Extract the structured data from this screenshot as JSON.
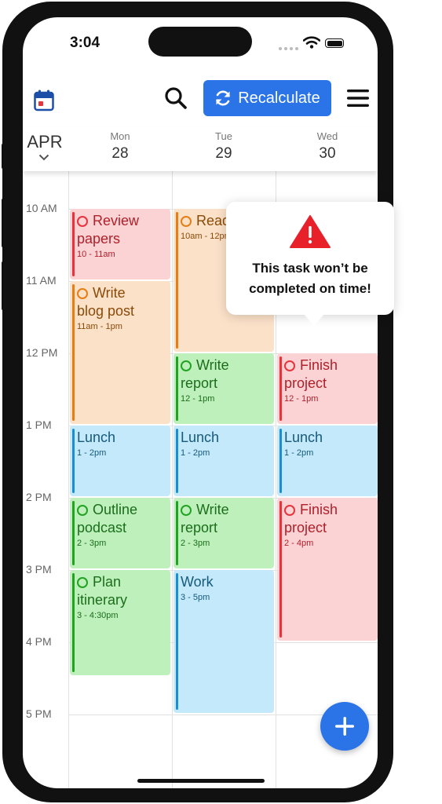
{
  "status_bar": {
    "time": "3:04"
  },
  "toolbar": {
    "recalculate_label": "Recalculate"
  },
  "header": {
    "month": "APR",
    "days": [
      {
        "name": "Mon",
        "date": "28"
      },
      {
        "name": "Tue",
        "date": "29"
      },
      {
        "name": "Wed",
        "date": "30"
      }
    ]
  },
  "time_labels": [
    "10 AM",
    "11 AM",
    "12 PM",
    "1 PM",
    "2 PM",
    "3 PM",
    "4 PM",
    "5 PM"
  ],
  "events": {
    "mon": [
      {
        "title1": "Review",
        "title2": "papers",
        "time": "10 - 11am"
      },
      {
        "title1": "Write",
        "title2": "blog post",
        "time": "11am - 1pm"
      },
      {
        "title1": "Lunch",
        "time": "1 - 2pm"
      },
      {
        "title1": "Outline",
        "title2": "podcast",
        "time": "2 - 3pm"
      },
      {
        "title1": "Plan",
        "title2": "itinerary",
        "time": "3 - 4:30pm"
      }
    ],
    "tue": [
      {
        "title1": "Read",
        "time": "10am - 12pm"
      },
      {
        "title1": "Write",
        "title2": "report",
        "time": "12 - 1pm"
      },
      {
        "title1": "Lunch",
        "time": "1 - 2pm"
      },
      {
        "title1": "Write",
        "title2": "report",
        "time": "2 - 3pm"
      },
      {
        "title1": "Work",
        "time": "3 - 5pm"
      }
    ],
    "wed": [
      {
        "title1": "Finish",
        "title2": "project",
        "time": "12 - 1pm"
      },
      {
        "title1": "Lunch",
        "time": "1 - 2pm"
      },
      {
        "title1": "Finish",
        "title2": "project",
        "time": "2 - 4pm"
      }
    ]
  },
  "warning": {
    "line1": "This task won’t be",
    "line2": "completed on time!"
  },
  "colors": {
    "accent": "#2b74e8",
    "red_bg": "#fbd3d5",
    "red_fg": "#b0202a",
    "red_bar": "#e8333d",
    "orange_bg": "#fbe1c8",
    "orange_fg": "#8a4a08",
    "orange_bar": "#e67e15",
    "green_bg": "#bdf0bb",
    "green_fg": "#1c6e1c",
    "green_bar": "#21a321",
    "blue_bg": "#c4e9fb",
    "blue_fg": "#155a7a",
    "blue_bar": "#1a8fcf"
  },
  "icons": [
    "calendar-icon",
    "search-icon",
    "refresh-icon",
    "menu-icon",
    "chevron-down-icon",
    "warning-icon",
    "plus-icon",
    "wifi-icon",
    "battery-icon"
  ]
}
